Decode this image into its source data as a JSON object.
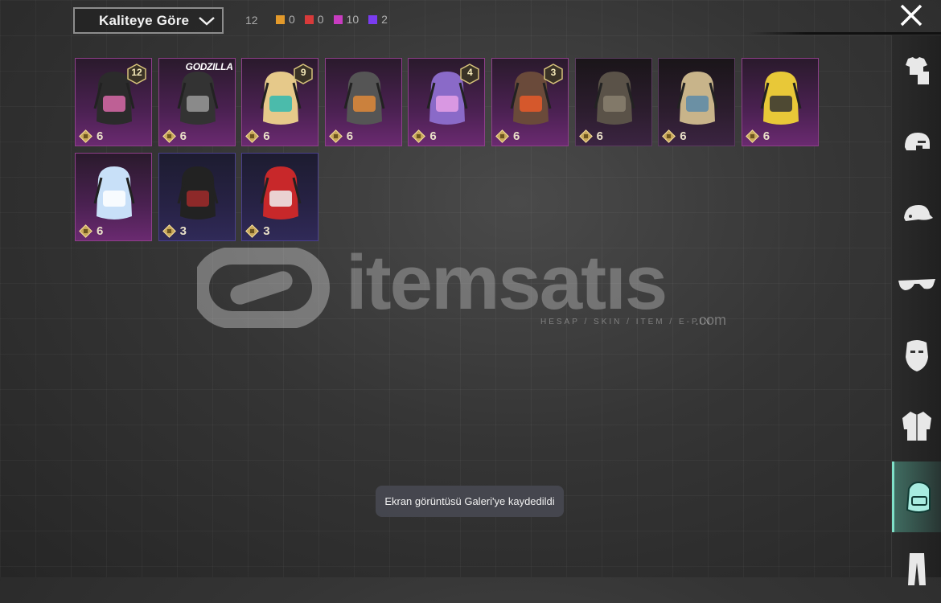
{
  "header": {
    "sort_label": "Kaliteye Göre",
    "total_count": "12",
    "quality_counts": [
      {
        "color": "#e39a2b",
        "count": "0"
      },
      {
        "color": "#d83a3a",
        "count": "0"
      },
      {
        "color": "#c83cc0",
        "count": "10"
      },
      {
        "color": "#7a3cf0",
        "count": "2"
      }
    ]
  },
  "items": [
    {
      "cost": "6",
      "level": "12",
      "brand": "",
      "rarity": "purple",
      "art": "backpack-pink-black"
    },
    {
      "cost": "6",
      "level": "",
      "brand": "GODZILLA",
      "rarity": "purple",
      "art": "backpack-godzilla"
    },
    {
      "cost": "6",
      "level": "9",
      "brand": "",
      "rarity": "purple",
      "art": "backpack-clown"
    },
    {
      "cost": "6",
      "level": "",
      "brand": "",
      "rarity": "purple",
      "art": "backpack-pickaxe"
    },
    {
      "cost": "6",
      "level": "4",
      "brand": "",
      "rarity": "purple",
      "art": "backpack-cat-pink"
    },
    {
      "cost": "6",
      "level": "3",
      "brand": "",
      "rarity": "purple",
      "art": "backpack-bear-orange"
    },
    {
      "cost": "6",
      "level": "",
      "brand": "",
      "rarity": "dark",
      "art": "backpack-spiky-flower"
    },
    {
      "cost": "6",
      "level": "",
      "brand": "",
      "rarity": "dark",
      "art": "backpack-graffiti"
    },
    {
      "cost": "6",
      "level": "",
      "brand": "",
      "rarity": "purple",
      "art": "backpack-yellow"
    },
    {
      "cost": "6",
      "level": "",
      "brand": "",
      "rarity": "purple",
      "art": "backpack-snowman"
    },
    {
      "cost": "3",
      "level": "",
      "brand": "",
      "rarity": "blue",
      "art": "backpack-dark-red"
    },
    {
      "cost": "3",
      "level": "",
      "brand": "",
      "rarity": "blue",
      "art": "backpack-red-liverpool"
    }
  ],
  "watermark": {
    "brand": "itemsatıs",
    "tagline": "HESAP / SKIN / ITEM / E-PIN",
    "suffix": ".com"
  },
  "sidebar": {
    "categories": [
      {
        "icon": "outfit-icon",
        "active": false
      },
      {
        "icon": "helmet-icon",
        "active": false
      },
      {
        "icon": "cap-icon",
        "active": false
      },
      {
        "icon": "glasses-icon",
        "active": false
      },
      {
        "icon": "mask-icon",
        "active": false
      },
      {
        "icon": "jacket-icon",
        "active": false
      },
      {
        "icon": "backpack-icon",
        "active": true
      },
      {
        "icon": "pants-icon",
        "active": false
      }
    ]
  },
  "toast": {
    "message": "Ekran görüntüsü Galeri'ye kaydedildi"
  }
}
